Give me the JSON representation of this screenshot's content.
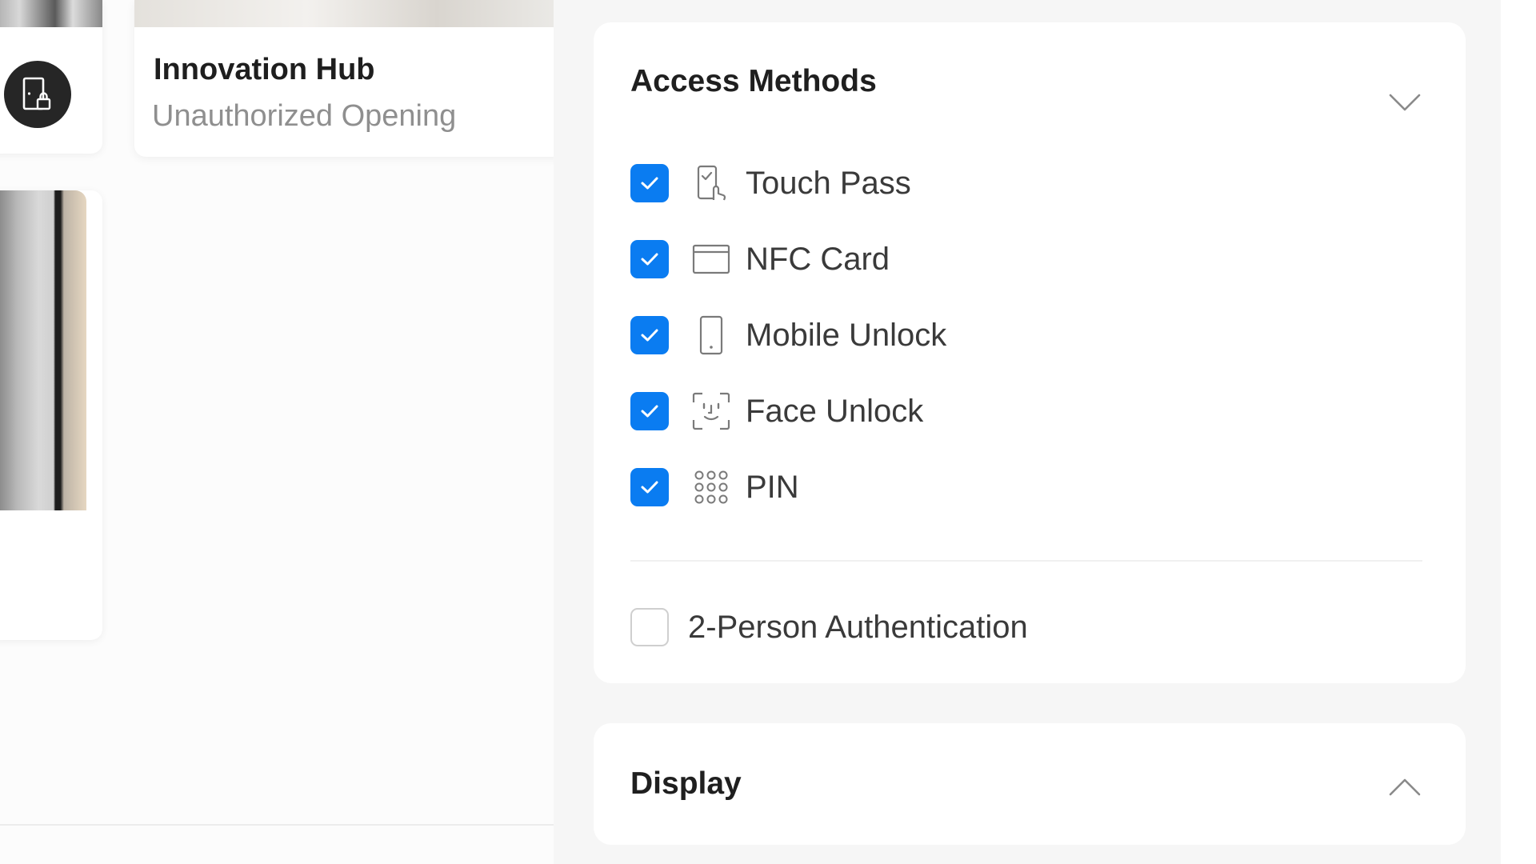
{
  "cards": {
    "featured": {
      "title": "Innovation Hub",
      "subtitle": "Unauthorized Opening"
    }
  },
  "access_methods": {
    "title": "Access Methods",
    "methods": [
      {
        "label": "Touch Pass",
        "icon": "touch-pass-icon",
        "checked": true
      },
      {
        "label": "NFC Card",
        "icon": "nfc-card-icon",
        "checked": true
      },
      {
        "label": "Mobile Unlock",
        "icon": "mobile-phone-icon",
        "checked": true
      },
      {
        "label": "Face Unlock",
        "icon": "face-scan-icon",
        "checked": true
      },
      {
        "label": "PIN",
        "icon": "keypad-icon",
        "checked": true
      }
    ],
    "two_person": {
      "label": "2-Person Authentication",
      "checked": false
    }
  },
  "display": {
    "title": "Display"
  },
  "colors": {
    "accent": "#0a7cf1",
    "badge": "#262626"
  }
}
